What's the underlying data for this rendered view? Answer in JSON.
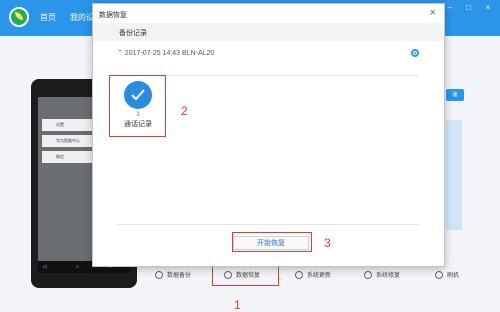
{
  "app": {
    "tabs": [
      "首页",
      "我的设"
    ],
    "window_controls": "–  □  ×"
  },
  "phone": {
    "cards": [
      "设置",
      "华为智能中心",
      "微信"
    ],
    "nav": "◁ ○ □"
  },
  "side": {
    "button_label": "速"
  },
  "actions": [
    "数据备份",
    "数据恢复",
    "系统更新",
    "系统修复",
    "刷机"
  ],
  "dialog": {
    "title": "数据恢复",
    "close": "×",
    "section": "备份记录",
    "record": "⌃  2017-07-25 14:43 BLN-AL20",
    "item": {
      "count": "3",
      "label": "通话记录"
    },
    "start_button": "开始恢复"
  },
  "annotations": [
    "1",
    "2",
    "3"
  ],
  "colors": {
    "accent": "#2b95ea",
    "annotation": "#e53935"
  }
}
